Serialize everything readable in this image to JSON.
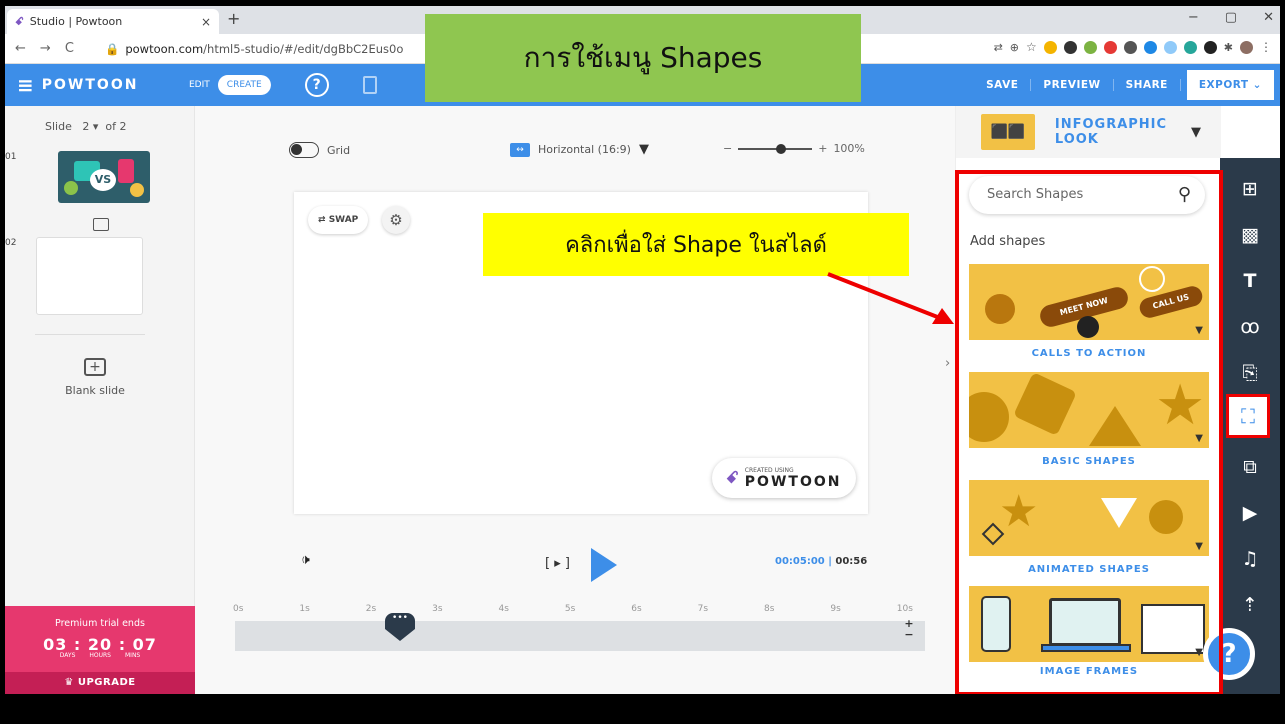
{
  "browser": {
    "tab_title": "Studio | Powtoon",
    "tab_close": "×",
    "new_tab": "+",
    "url_host": "powtoon.com",
    "url_path": "/html5-studio/#/edit/dgBbC2Eus0o"
  },
  "overlay": {
    "title": "การใช้เมนู Shapes",
    "note": "คลิกเพื่อใส่ Shape ในสไลด์"
  },
  "appbar": {
    "logo": "POWTOON",
    "edit": "EDIT",
    "create": "CREATE",
    "save": "SAVE",
    "preview": "PREVIEW",
    "share": "SHARE",
    "export": "EXPORT"
  },
  "slides": {
    "label": "Slide",
    "current": "2",
    "of": "of 2",
    "num1": "01",
    "num2": "02",
    "thumb1_text": "VS",
    "blank_slide": "Blank slide"
  },
  "premium": {
    "label": "Premium trial ends",
    "timer": "03 : 20 : 07",
    "days": "DAYS",
    "hours": "HOURS",
    "mins": "MINS",
    "upgrade": "UPGRADE"
  },
  "canvas": {
    "grid": "Grid",
    "orientation": "Horizontal (16:9)",
    "zoom": "100%",
    "swap": "SWAP",
    "created_small": "CREATED USING",
    "created_big": "POWTOON"
  },
  "playback": {
    "current": "00:05:00",
    "total": "00:56",
    "ticks": [
      "0s",
      "1s",
      "2s",
      "3s",
      "4s",
      "5s",
      "6s",
      "7s",
      "8s",
      "9s",
      "10s"
    ]
  },
  "shapes": {
    "header": "INFOGRAPHIC LOOK",
    "search_placeholder": "Search Shapes",
    "add_shapes": "Add shapes",
    "categories": [
      {
        "label": "CALLS TO ACTION",
        "meet": "MEET NOW",
        "call": "CALL US"
      },
      {
        "label": "BASIC SHAPES"
      },
      {
        "label": "ANIMATED SHAPES"
      },
      {
        "label": "IMAGE FRAMES"
      }
    ]
  },
  "colors": {
    "accent": "#3d8ee8",
    "cards": "#f2c145",
    "toolbar": "#2b3a4a",
    "highlight": "#ee0000"
  }
}
